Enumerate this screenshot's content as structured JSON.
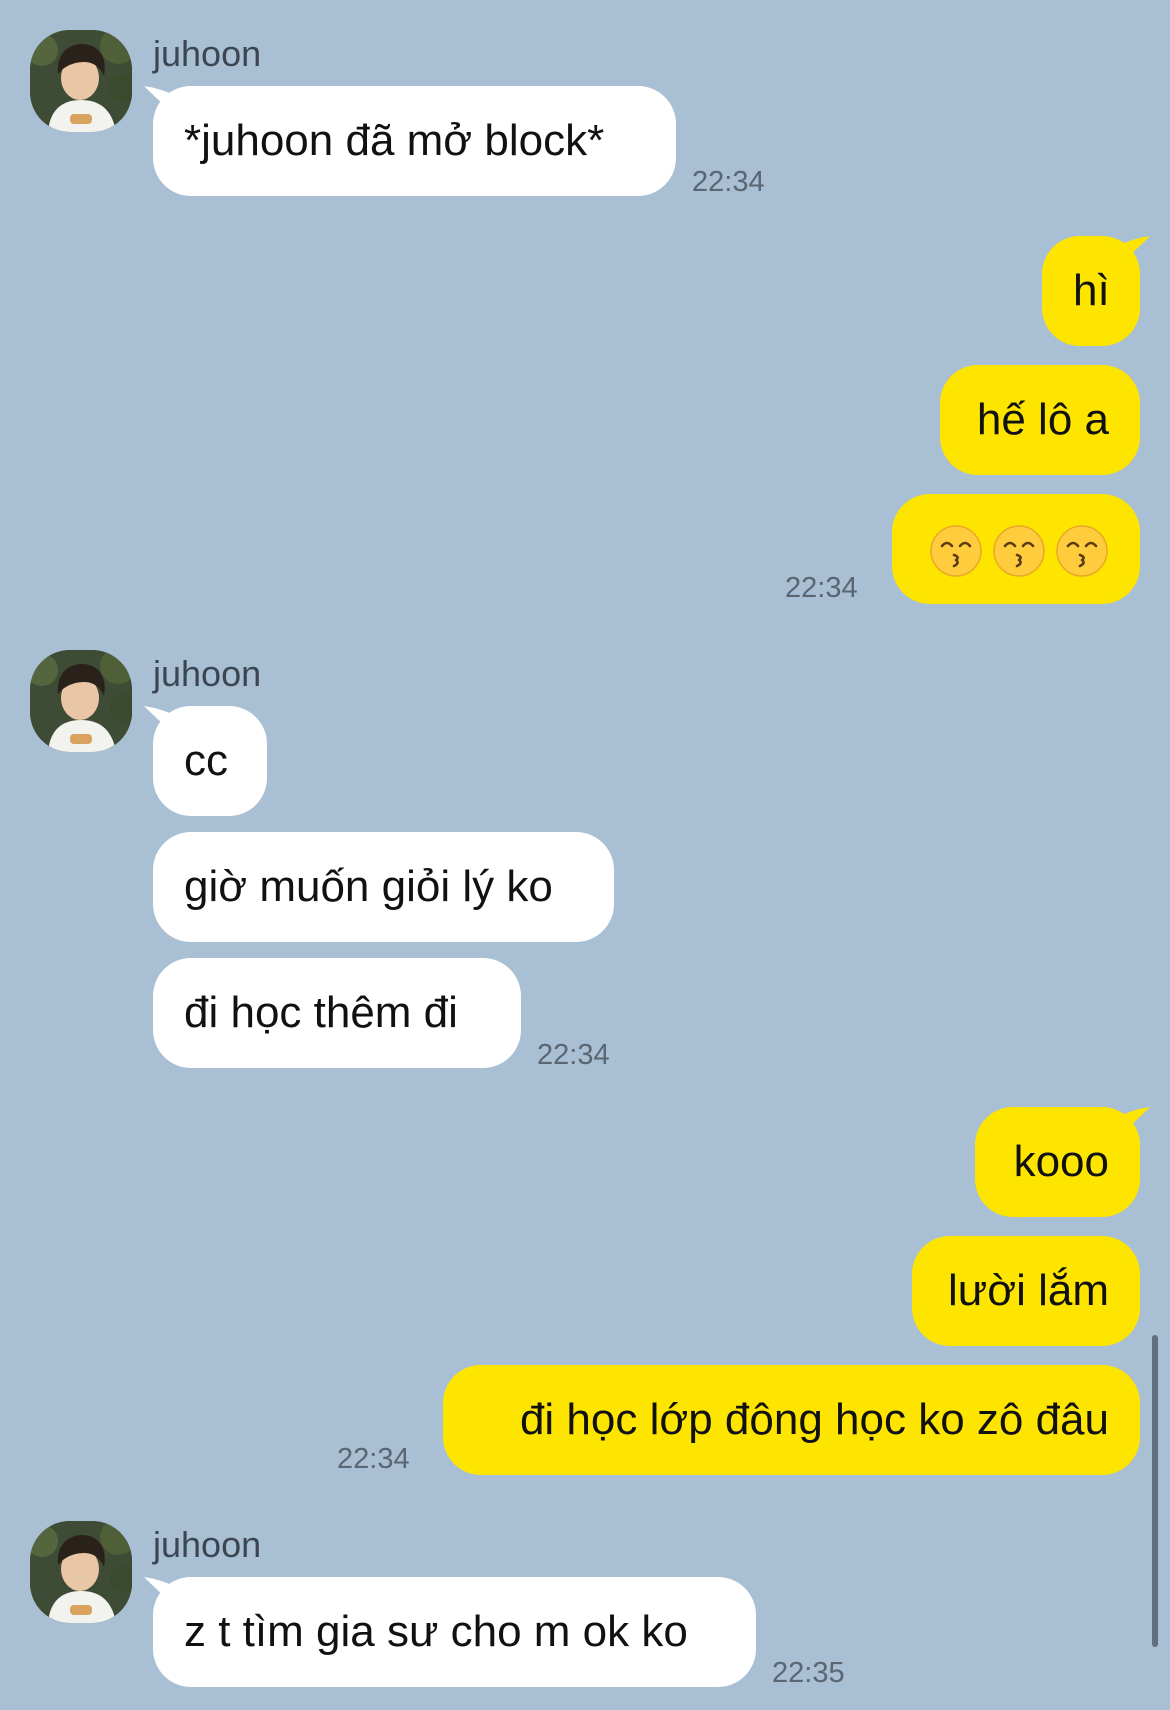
{
  "colors": {
    "background": "#a9bfd3",
    "incoming_bubble": "#ffffff",
    "outgoing_bubble": "#fee500",
    "timestamp": "#5a6672",
    "sender_name": "#3c4652"
  },
  "messages": [
    {
      "group": "incoming",
      "sender": "juhoon",
      "avatar_icon": "profile-photo",
      "bubbles": [
        "*juhoon đã mở block*"
      ],
      "time": "22:34"
    },
    {
      "group": "outgoing",
      "bubbles": [
        "hì",
        "hế lô a",
        ""
      ],
      "emoji": [
        "kissing-face-with-smiling-eyes-icon",
        "kissing-face-with-smiling-eyes-icon",
        "kissing-face-with-smiling-eyes-icon"
      ],
      "time": "22:34"
    },
    {
      "group": "incoming",
      "sender": "juhoon",
      "avatar_icon": "profile-photo",
      "bubbles": [
        "cc",
        "giờ muốn giỏi lý ko",
        "đi học thêm đi"
      ],
      "time": "22:34"
    },
    {
      "group": "outgoing",
      "bubbles": [
        "kooo",
        "lười lắm",
        "đi học lớp đông học ko zô đâu"
      ],
      "time": "22:34"
    },
    {
      "group": "incoming",
      "sender": "juhoon",
      "avatar_icon": "profile-photo",
      "bubbles": [
        "z t tìm gia sư cho m ok ko"
      ],
      "time": "22:35"
    }
  ]
}
